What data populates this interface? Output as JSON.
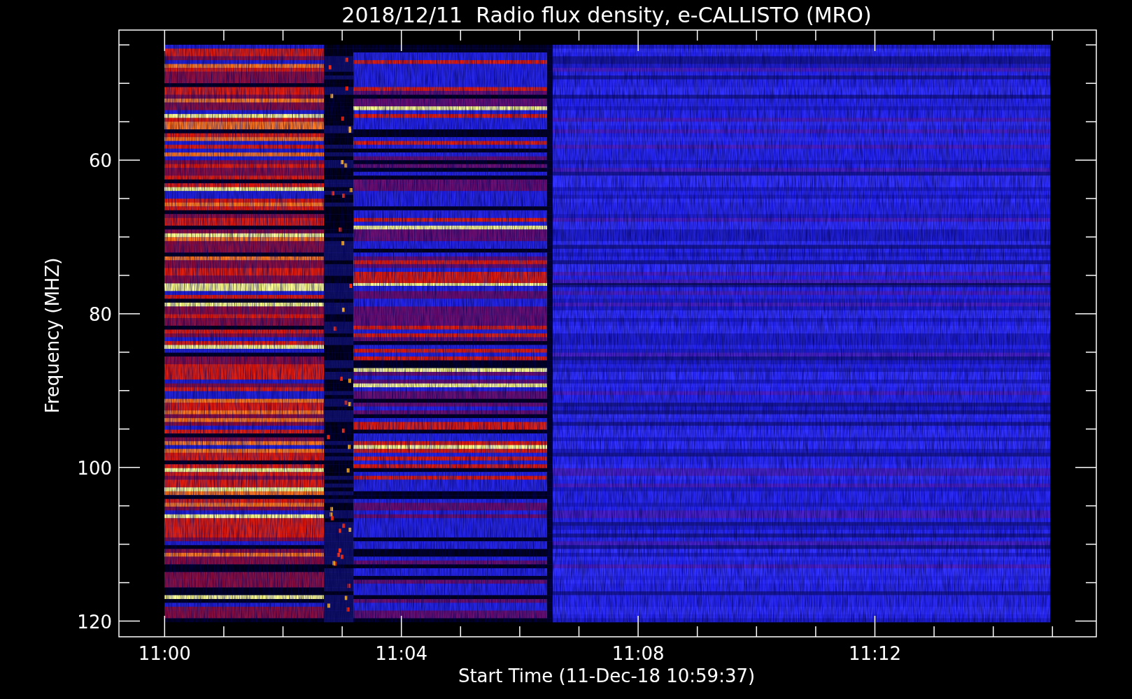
{
  "title": "2018/12/11  Radio flux density, e-CALLISTO (MRO)",
  "plot": {
    "xlabel": "Start Time (11-Dec-18 10:59:37)",
    "ylabel": "Frequency (MHZ)",
    "xticks": [
      "11:00",
      "11:04",
      "11:08",
      "11:12"
    ],
    "yticks": [
      "60",
      "80",
      "100",
      "120"
    ]
  }
}
